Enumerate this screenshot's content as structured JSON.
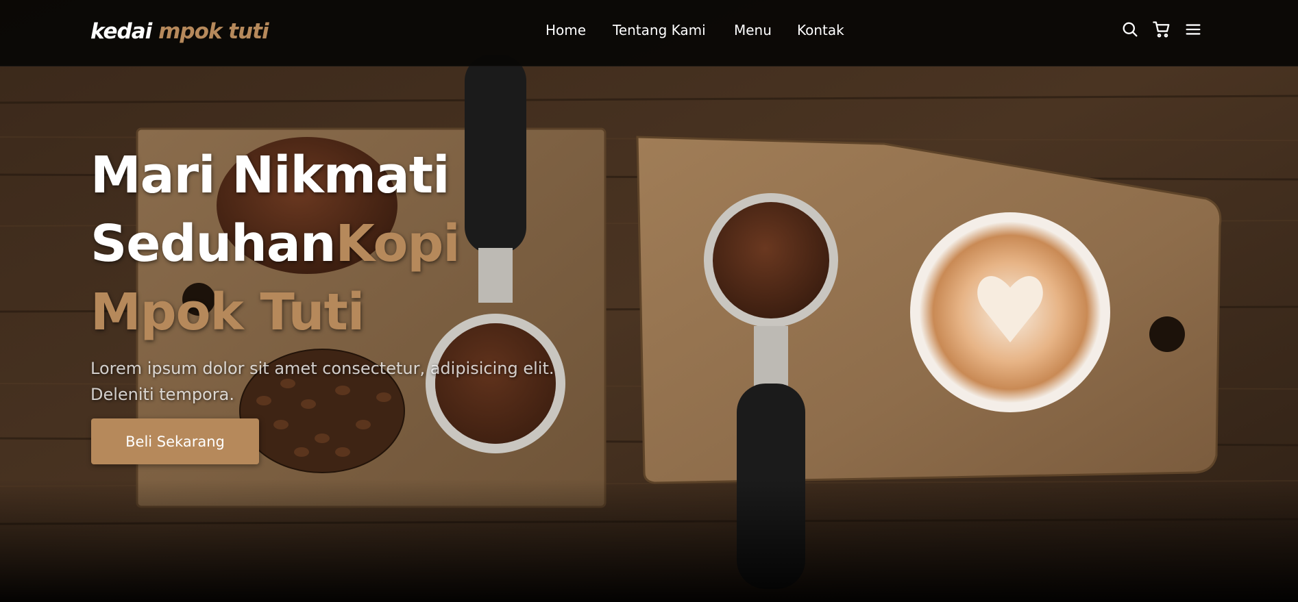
{
  "navbar": {
    "logo": {
      "part1": "kedai ",
      "part2": "mpok tuti"
    },
    "links": [
      {
        "label": "Home"
      },
      {
        "label": "Tentang Kami"
      },
      {
        "label": "Menu"
      },
      {
        "label": "Kontak"
      }
    ],
    "icons": [
      "search-icon",
      "cart-icon",
      "hamburger-menu-icon"
    ]
  },
  "hero": {
    "title_line1": "Mari Nikmati",
    "title_line2_white": "Seduhan",
    "title_line2_accent": "Kopi",
    "title_line3_accent": "Mpok Tuti",
    "description": "Lorem ipsum dolor sit amet consectetur, adipisicing elit. Deleniti tempora.",
    "cta_label": "Beli Sekarang"
  },
  "colors": {
    "accent": "#b6895b",
    "navbar_bg": "#080604",
    "text": "#ffffff"
  }
}
